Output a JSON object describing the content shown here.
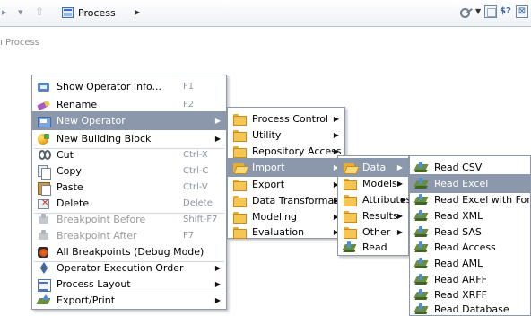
{
  "toolbar": {
    "process_label": "Process",
    "icons": [
      "back-arrow-icon",
      "dropdown-icon",
      "up-arrow-icon",
      "process-icon",
      "chevron-right-icon",
      "key-icon",
      "frame-icon",
      "help-icon",
      "close-icon"
    ]
  },
  "panel": {
    "title": "Process"
  },
  "context_menu": {
    "items": [
      {
        "label": "Show Operator Info...",
        "shortcut": "F1",
        "icon": "info-icon"
      },
      {
        "label": "Rename",
        "shortcut": "F2",
        "icon": "rename-icon"
      },
      {
        "label": "New Operator",
        "icon": "new-operator-icon",
        "submenu": true,
        "selected": true
      },
      {
        "label": "New Building Block",
        "icon": "building-block-icon",
        "submenu": true
      },
      {
        "label": "Cut",
        "shortcut": "Ctrl-X",
        "icon": "cut-icon"
      },
      {
        "label": "Copy",
        "shortcut": "Ctrl-C",
        "icon": "copy-icon"
      },
      {
        "label": "Paste",
        "shortcut": "Ctrl-V",
        "icon": "paste-icon"
      },
      {
        "label": "Delete",
        "shortcut": "Delete",
        "icon": "delete-icon"
      },
      {
        "label": "Breakpoint Before",
        "shortcut": "Shift-F7",
        "icon": "breakpoint-icon",
        "disabled": true
      },
      {
        "label": "Breakpoint After",
        "shortcut": "F7",
        "icon": "breakpoint-icon",
        "disabled": true
      },
      {
        "label": "All Breakpoints (Debug Mode)",
        "icon": "all-breakpoints-icon"
      },
      {
        "label": "Operator Execution Order",
        "icon": "execution-order-icon",
        "submenu": true
      },
      {
        "label": "Process Layout",
        "icon": "layout-icon",
        "submenu": true
      },
      {
        "label": "Export/Print",
        "icon": "export-icon",
        "submenu": true
      }
    ]
  },
  "submenu_operators": {
    "items": [
      {
        "label": "Process Control",
        "icon": "folder-icon",
        "submenu": true
      },
      {
        "label": "Utility",
        "icon": "folder-icon",
        "submenu": true
      },
      {
        "label": "Repository Access",
        "icon": "folder-icon",
        "submenu": true
      },
      {
        "label": "Import",
        "icon": "folder-open-icon",
        "submenu": true,
        "selected": true
      },
      {
        "label": "Export",
        "icon": "folder-icon",
        "submenu": true
      },
      {
        "label": "Data Transformation",
        "icon": "folder-icon",
        "submenu": true
      },
      {
        "label": "Modeling",
        "icon": "folder-icon",
        "submenu": true
      },
      {
        "label": "Evaluation",
        "icon": "folder-icon",
        "submenu": true
      }
    ]
  },
  "submenu_import": {
    "items": [
      {
        "label": "Data",
        "icon": "folder-open-icon",
        "submenu": true,
        "selected": true
      },
      {
        "label": "Models",
        "icon": "folder-icon",
        "submenu": true
      },
      {
        "label": "Attributes",
        "icon": "folder-icon",
        "submenu": true
      },
      {
        "label": "Results",
        "icon": "folder-icon",
        "submenu": true
      },
      {
        "label": "Other",
        "icon": "folder-icon",
        "submenu": true
      },
      {
        "label": "Read",
        "icon": "read-icon"
      }
    ]
  },
  "submenu_data": {
    "items": [
      {
        "label": "Read CSV"
      },
      {
        "label": "Read Excel",
        "selected": true
      },
      {
        "label": "Read Excel with Format"
      },
      {
        "label": "Read XML"
      },
      {
        "label": "Read SAS"
      },
      {
        "label": "Read Access"
      },
      {
        "label": "Read AML"
      },
      {
        "label": "Read ARFF"
      },
      {
        "label": "Read XRFF"
      },
      {
        "label": "Read Database"
      }
    ]
  }
}
